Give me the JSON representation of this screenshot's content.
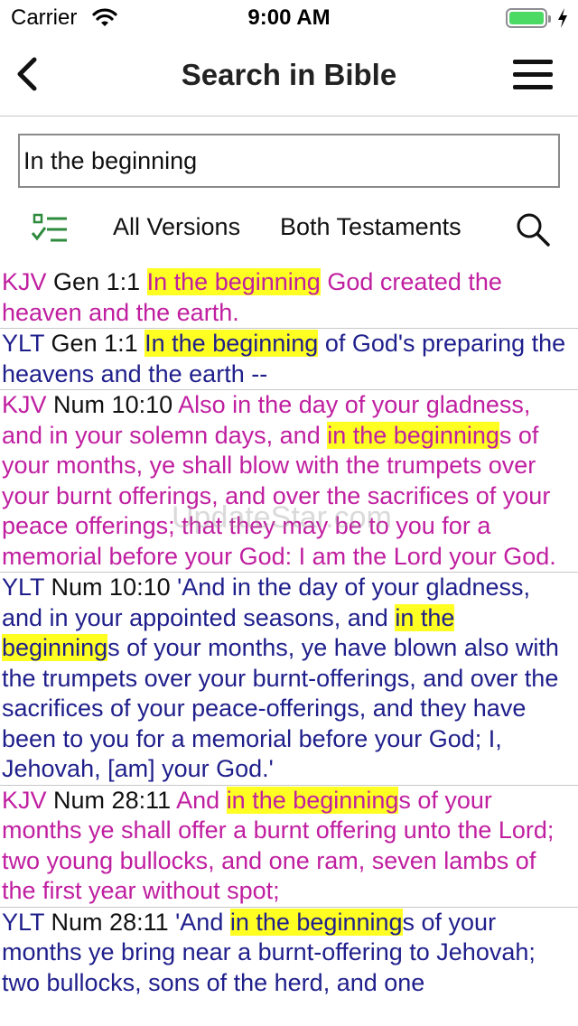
{
  "status": {
    "carrier": "Carrier",
    "time": "9:00 AM"
  },
  "nav": {
    "title": "Search in Bible"
  },
  "search": {
    "value": "In the beginning"
  },
  "toolbar": {
    "versions": "All Versions",
    "testaments": "Both Testaments"
  },
  "watermark": "UpdateStar.com",
  "colors": {
    "kjv": "#c01fa0",
    "ylt": "#1f1f8c",
    "highlight": "#ffff22"
  },
  "results": [
    {
      "version": "KJV",
      "ref": "Gen 1:1",
      "before": "",
      "match": "In the beginning",
      "after": " God created the heaven and the earth."
    },
    {
      "version": "YLT",
      "ref": "Gen 1:1",
      "before": "",
      "match": "In the beginning",
      "after": " of God's preparing the heavens and the earth --"
    },
    {
      "version": "KJV",
      "ref": "Num 10:10",
      "before": "Also in the day of your gladness, and in your solemn days, and ",
      "match": "in the beginning",
      "after": "s of your months, ye shall blow with the trumpets over your burnt offerings, and over the sacrifices of your peace offerings; that they may be to you for a memorial before your God: I am the Lord your God."
    },
    {
      "version": "YLT",
      "ref": "Num 10:10",
      "before": "'And in the day of your gladness, and in your appointed seasons, and ",
      "match": "in the beginning",
      "after": "s of your months, ye have blown also with the trumpets over your burnt-offerings, and over the sacrifices of your peace-offerings, and they have been to you for a memorial before your God; I, Jehovah, [am] your God.'"
    },
    {
      "version": "KJV",
      "ref": "Num 28:11",
      "before": "And ",
      "match": "in the beginning",
      "after": "s of your months ye shall offer a burnt offering unto the Lord; two young bullocks, and one ram, seven lambs of the first year without spot;"
    },
    {
      "version": "YLT",
      "ref": "Num 28:11",
      "before": "'And ",
      "match": "in the beginning",
      "after": "s of your months ye bring near a burnt-offering to Jehovah; two bullocks, sons of the herd, and one"
    }
  ]
}
